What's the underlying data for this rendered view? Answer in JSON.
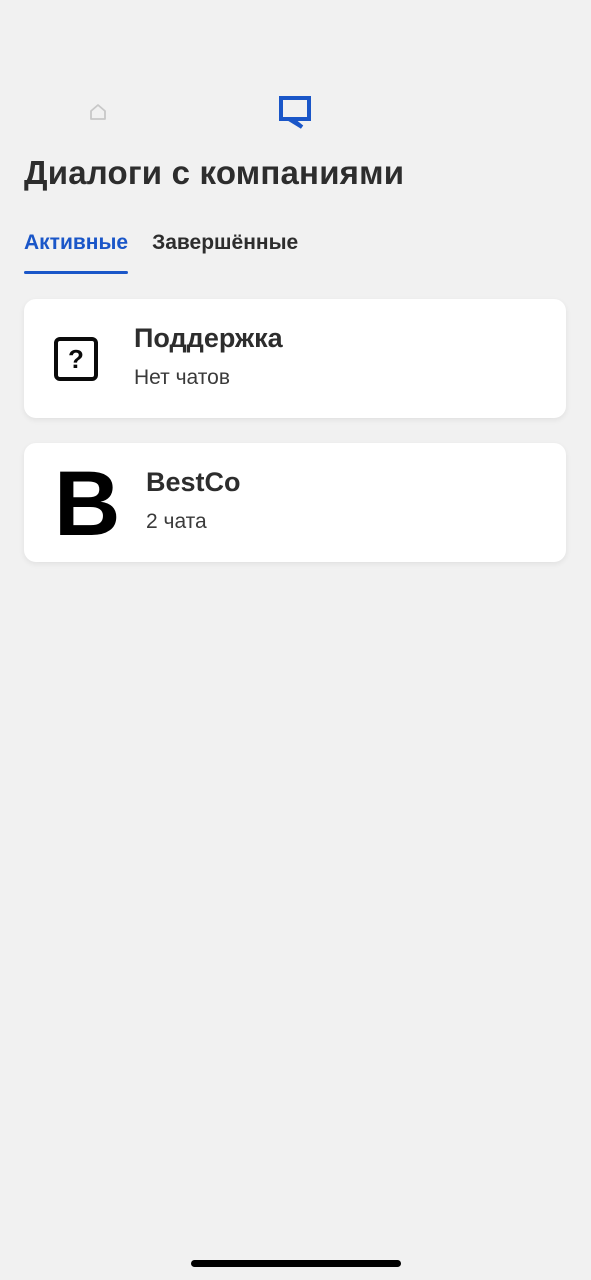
{
  "nav": {
    "home_icon": "home-icon",
    "chat_icon": "chat-icon",
    "active_color": "#1a56c8",
    "inactive_color": "#c8c8c8"
  },
  "header": {
    "title": "Диалоги с компаниями"
  },
  "tabs": [
    {
      "label": "Активные",
      "active": true
    },
    {
      "label": "Завершённые",
      "active": false
    }
  ],
  "dialogs": [
    {
      "name": "Поддержка",
      "subtitle": "Нет чатов",
      "icon": "help-icon",
      "icon_glyph": "?"
    },
    {
      "name": "BestCo",
      "subtitle": "2 чата",
      "icon": "bestco-logo",
      "logo_letter": "B"
    }
  ],
  "colors": {
    "background": "#f1f1f1",
    "card": "#ffffff",
    "accent": "#1a56c8",
    "text": "#2d2d2d"
  }
}
